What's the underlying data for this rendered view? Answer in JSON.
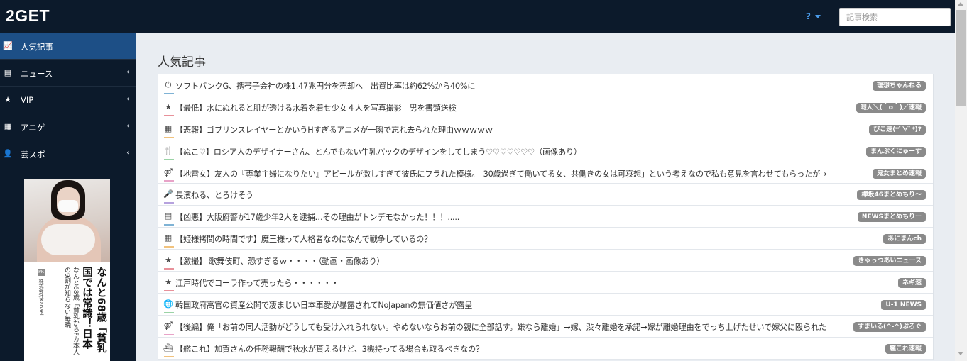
{
  "header": {
    "logo": "2GET",
    "help_label": "?",
    "search_placeholder": "記事検索"
  },
  "sidebar": {
    "items": [
      {
        "icon": "chart-line-icon",
        "glyph": "📈",
        "label": "人気記事",
        "active": true,
        "has_caret": false
      },
      {
        "icon": "newspaper-icon",
        "glyph": "▤",
        "label": "ニュース",
        "active": false,
        "has_caret": true
      },
      {
        "icon": "star-icon",
        "glyph": "★",
        "label": "VIP",
        "active": false,
        "has_caret": true
      },
      {
        "icon": "film-icon",
        "glyph": "▦",
        "label": "アニゲ",
        "active": false,
        "has_caret": true
      },
      {
        "icon": "user-icon",
        "glyph": "👤",
        "label": "芸スポ",
        "active": false,
        "has_caret": true
      }
    ],
    "ad": {
      "pr_label": "PR",
      "sponsor": "株式会社Kanael",
      "headline": "なんと68歳「貧乳国では常識！日本",
      "body": "なんと68歳「貧乳からFカ本人の9割が知らない毎晩"
    }
  },
  "main": {
    "title": "人気記事",
    "articles": [
      {
        "icon": "power-icon",
        "glyph": "⏻",
        "title": "ソフトバンクG、携帯子会社の株1.47兆円分を売却へ　出資比率は約62%から40%に",
        "source": "理想ちゃんねる",
        "accent": "#7fb3d5"
      },
      {
        "icon": "star-icon",
        "glyph": "★",
        "title": "【最低】水にぬれると肌が透ける水着を着せ少女４人を写真撮影　男を書類送検",
        "source": "暇人＼(＾o＾)／速報",
        "accent": "#e8919a"
      },
      {
        "icon": "film-icon",
        "glyph": "▦",
        "title": "【悲報】ゴブリンスレイヤーとかいうHすぎるアニメが一瞬で忘れ去られた理由ｗｗｗｗｗ",
        "source": "ぴこ速(*ﾟ∀ﾟ*)?",
        "accent": "#f1c27d"
      },
      {
        "icon": "cutlery-icon",
        "glyph": "🍴",
        "title": "【ぬこ♡】ロシア人のデザイナーさん、とんでもない牛乳パックのデザインをしてしまう♡♡♡♡♡♡♡（画像あり）",
        "source": "まんぷくにゅーす",
        "accent": "#9bd3a6"
      },
      {
        "icon": "gender-icon",
        "glyph": "⚤",
        "title": "【地雷女】友人の『専業主婦になりたい』アピールが激しすぎて彼氏にフラれた模様。「30歳過ぎて働いてる女、共働きの女は可哀想」という考えなので私も意見を言わせてもらったが→",
        "source": "鬼女まとめ速報",
        "accent": "#e8a3c8"
      },
      {
        "icon": "microphone-icon",
        "glyph": "🎤",
        "title": "長濱ねる、とろけそう",
        "source": "欅坂46まとめもり～",
        "accent": "#b6a2de"
      },
      {
        "icon": "newspaper-icon",
        "glyph": "▤",
        "title": "【凶悪】大阪府警が17歳少年2人を逮捕…その理由がトンデモなかった！！！.....",
        "source": "NEWSまとめもりー",
        "accent": "#7fb3d5"
      },
      {
        "icon": "film-icon",
        "glyph": "▦",
        "title": "【姫様拷問の時間です】魔王様って人格者なのになんで戦争しているの？",
        "source": "あにまんch",
        "accent": "#f1c27d"
      },
      {
        "icon": "star-icon",
        "glyph": "★",
        "title": "【激撮】 歌舞伎町、恐すぎるｗ・・・・（動画・画像あり）",
        "source": "きゃっつあいニュース",
        "accent": "#e8919a"
      },
      {
        "icon": "star-icon",
        "glyph": "★",
        "title": "江戸時代でコーラ作って売ったら・・・・・・",
        "source": "ネギ速",
        "accent": "#e8919a"
      },
      {
        "icon": "globe-icon",
        "glyph": "🌐",
        "title": "韓国政府高官の資産公開で凄まじい日本車愛が暴露されてNoJapanの無価値さが露呈",
        "source": "U-1 NEWS",
        "accent": "#9bd3a6"
      },
      {
        "icon": "gender-icon",
        "glyph": "⚤",
        "title": "【後編】俺「お前の同人活動がどうしても受け入れられない。やめないならお前の親に全部話す。嫌なら離婚」→嫁、渋々離婚を承諾→嫁が離婚理由をでっち上げたせいで嫁父に殴られた",
        "source": "すまいる(^-^)ぶろぐ",
        "accent": "#e8a3c8"
      },
      {
        "icon": "ship-icon",
        "glyph": "⛴",
        "title": "【艦これ】加賀さんの任務報酬で秋水が貰えるけど、3機持ってる場合も取るべきなの？",
        "source": "艦これ速報",
        "accent": "#f1c27d"
      }
    ]
  },
  "colors": {
    "topbar": "#0c1a2b",
    "sidebar_active": "#1d4f86",
    "help_accent": "#4a9ae8",
    "badge": "#8a8a8a"
  }
}
